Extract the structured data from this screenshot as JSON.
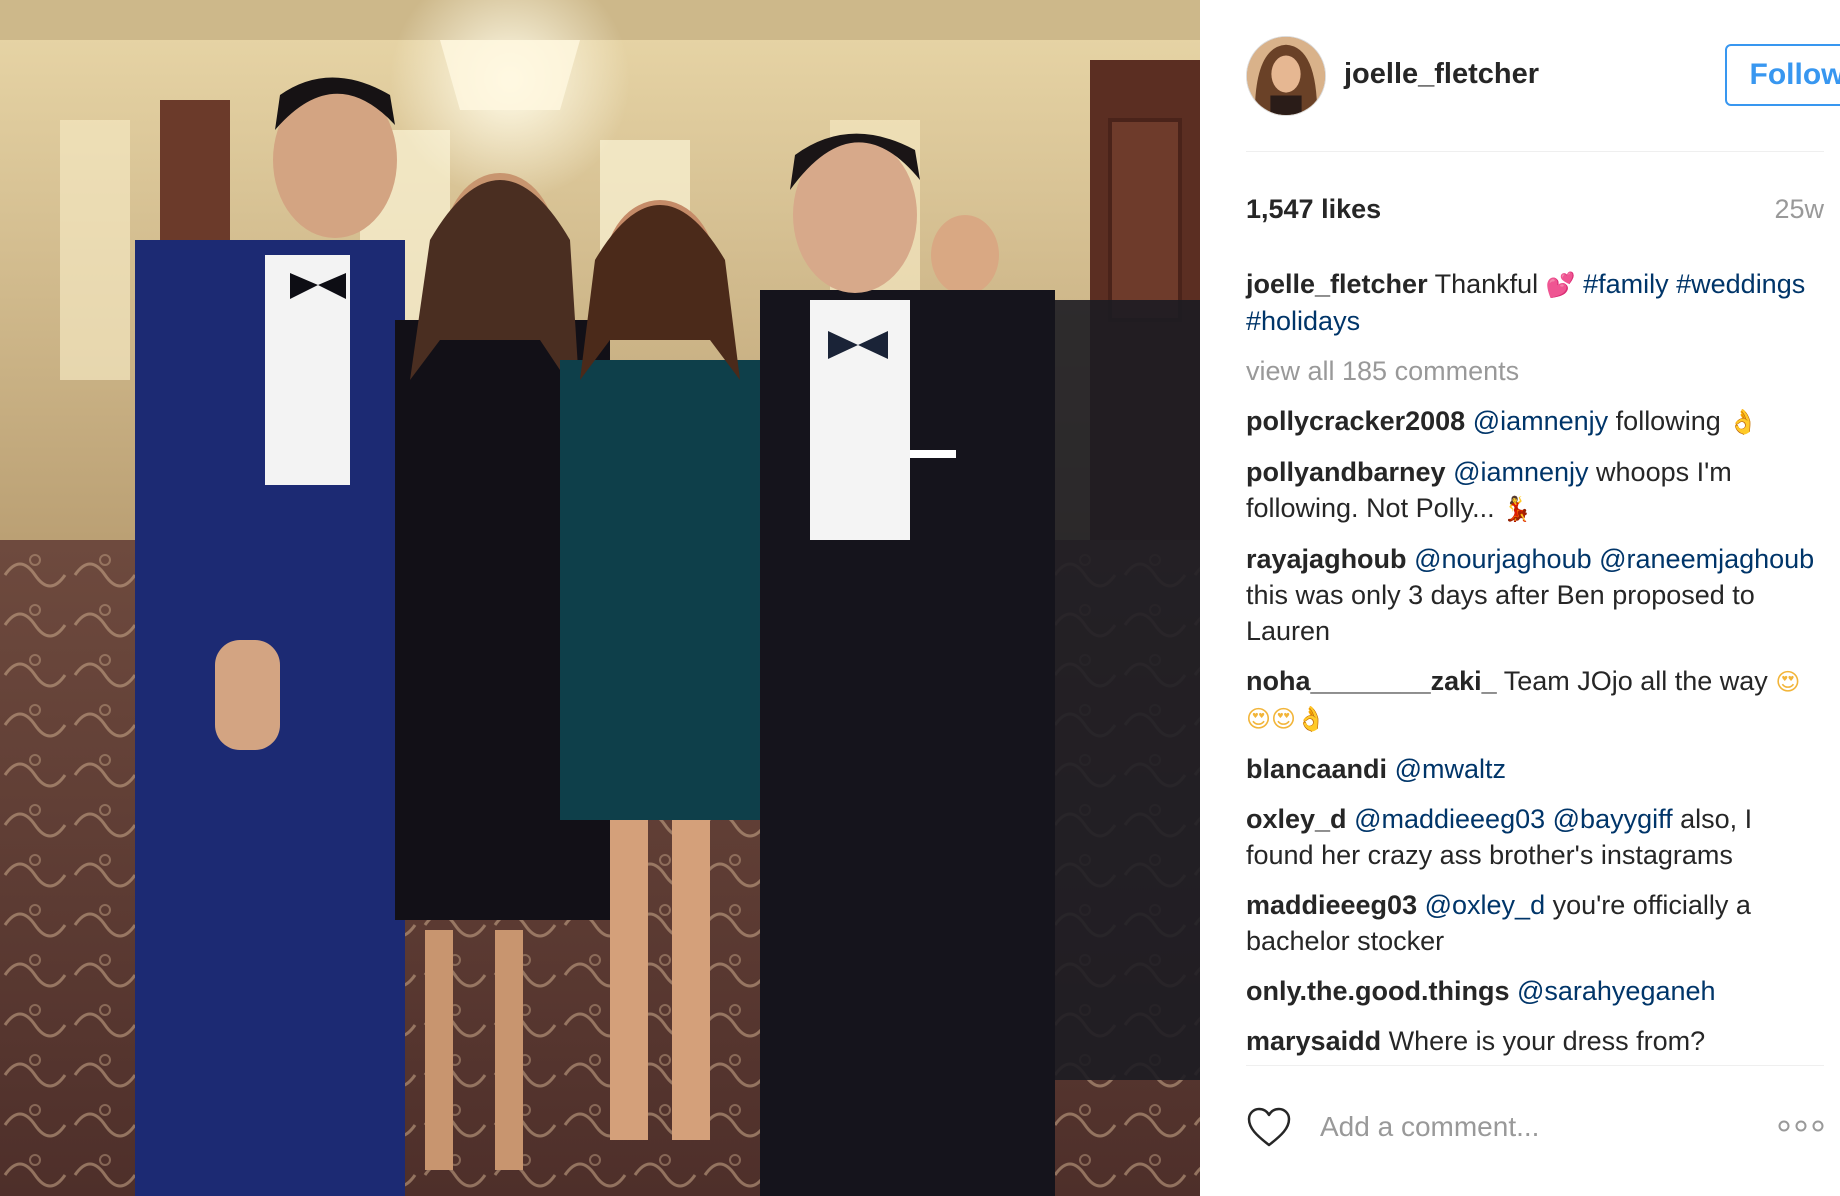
{
  "post": {
    "username": "joelle_fletcher",
    "follow_label": "Follow",
    "likes": "1,547 likes",
    "time_ago": "25w",
    "caption": {
      "username": "joelle_fletcher",
      "text": "Thankful",
      "emoji": "💕",
      "tag_family": "#family",
      "tag_weddings": "#weddings",
      "tag_holidays": "#holidays"
    },
    "view_all": "view all 185 comments",
    "comments": [
      {
        "user": "pollycracker2008",
        "mention": "@iamnenjy",
        "text": "following",
        "emoji": "👌"
      },
      {
        "user": "pollyandbarney",
        "mention": "@iamnenjy",
        "text": "whoops I'm following. Not Polly...",
        "emoji": "💃"
      },
      {
        "user": "rayajaghoub",
        "mention": "@nourjaghoub",
        "mention2": "@raneemjaghoub",
        "text": "this was only 3 days after Ben proposed to Lauren"
      },
      {
        "user": "noha________zaki_",
        "text": "Team JOjo all the way",
        "emoji": "😍😍😍👌"
      },
      {
        "user": "blancaandi",
        "mention": "@mwaltz"
      },
      {
        "user": "oxley_d",
        "mention": "@maddieeeg03",
        "mention2": "@bayygiff",
        "text": "also, I found her crazy ass brother's instagrams"
      },
      {
        "user": "maddieeeg03",
        "mention": "@oxley_d",
        "text": "you're officially a bachelor stocker"
      },
      {
        "user": "only.the.good.things",
        "mention": "@sarahyeganeh"
      },
      {
        "user": "marysaidd",
        "text": "Where is your dress from?"
      }
    ],
    "comment_placeholder": "Add a comment...",
    "icons": {
      "like": "heart-icon",
      "more": "more-options-icon"
    },
    "colors": {
      "link": "#003569",
      "follow": "#3897f0",
      "muted": "#999999"
    }
  }
}
